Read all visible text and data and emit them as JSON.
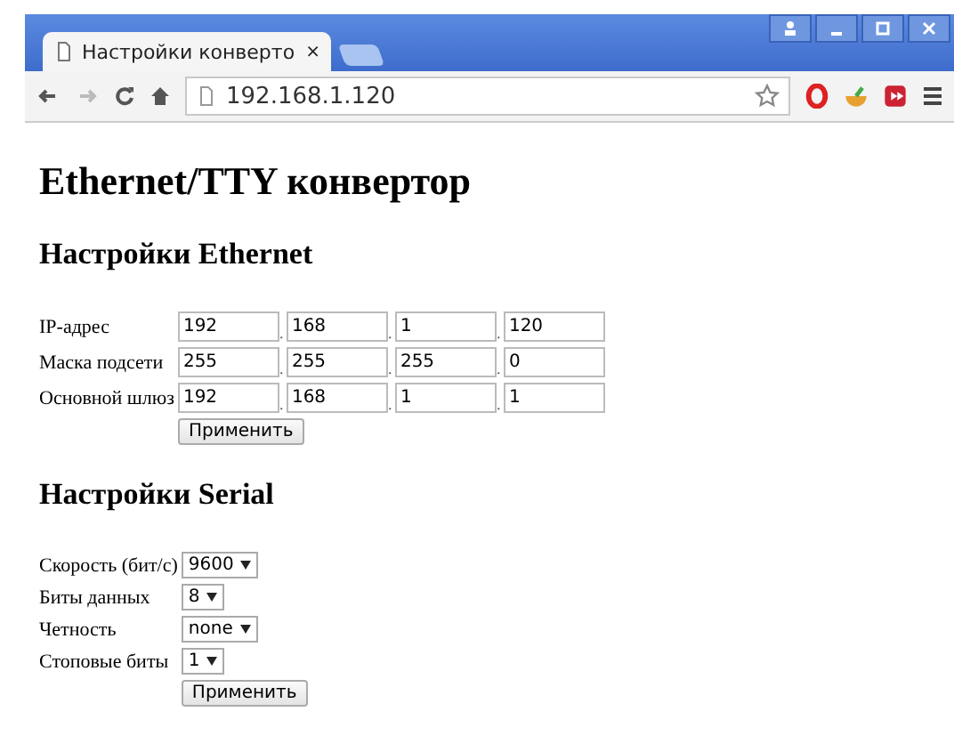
{
  "browser": {
    "tab_title": "Настройки конверто",
    "tab_close": "×",
    "address": "192.168.1.120"
  },
  "page": {
    "title": "Ethernet/TTY конвертор",
    "ethernet": {
      "heading": "Настройки Ethernet",
      "separator": ".",
      "rows": [
        {
          "label": "IP-адрес",
          "values": [
            "192",
            "168",
            "1",
            "120"
          ]
        },
        {
          "label": "Маска подсети",
          "values": [
            "255",
            "255",
            "255",
            "0"
          ]
        },
        {
          "label": "Основной шлюз",
          "values": [
            "192",
            "168",
            "1",
            "1"
          ]
        }
      ],
      "apply": "Применить"
    },
    "serial": {
      "heading": "Настройки Serial",
      "rows": [
        {
          "label": "Скорость (бит/с)",
          "value": "9600"
        },
        {
          "label": "Биты данных",
          "value": "8"
        },
        {
          "label": "Четность",
          "value": "none"
        },
        {
          "label": "Стоповые биты",
          "value": "1"
        }
      ],
      "apply": "Применить"
    }
  }
}
